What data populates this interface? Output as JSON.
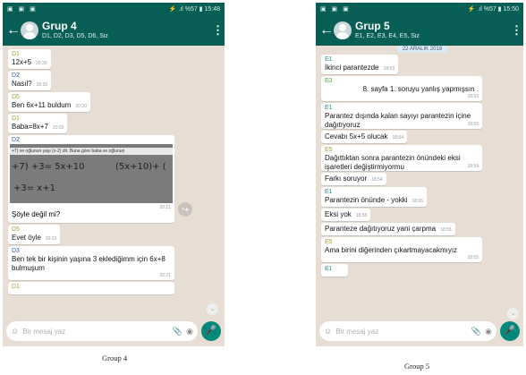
{
  "left": {
    "status": {
      "left": "▣ ▣ ▣",
      "right": "⚡ .ıl %57 ▮ 15:48"
    },
    "header": {
      "title": "Grup 4",
      "members": "D1, D2, D3, D5, D6, Siz"
    },
    "messages": [
      {
        "sender": "D1",
        "text": "12x+5",
        "time": "20:20"
      },
      {
        "sender": "D2",
        "text": "Nasıl?",
        "time": "20:20"
      },
      {
        "sender": "D5",
        "text": "Ben 6x+11 buldum",
        "time": "20:20"
      },
      {
        "sender": "D1",
        "text": "Baba=8x+7",
        "time": "20:20"
      },
      {
        "sender": "D2",
        "image_caption": "+7) ve oğlunun yaşı (x-2) dir. Buna göre baba ve oğlunun",
        "hw1": "+7) +3= 5x+10",
        "hw2": "(5x+10)+ (",
        "hw3": "+3= x+1",
        "text": "Şöyle değil mi?",
        "time": "20:21"
      },
      {
        "sender": "D5",
        "text": "Evet öyle",
        "time": "20:21"
      },
      {
        "sender": "D3",
        "text": "Ben tek bir kişinin yaşına 3 eklediğimm için 6x+8 bulmuşum",
        "time": "20:21"
      },
      {
        "sender": "D1",
        "text": "",
        "time": ""
      }
    ],
    "input_placeholder": "Bir mesaj yaz",
    "caption": "Group 4"
  },
  "right": {
    "status": {
      "left": "▣ ▣ ▣",
      "right": "⚡ .ıl %57 ▮ 15:50"
    },
    "header": {
      "title": "Grup 5",
      "members": "E1, E2, E3, E4, E5, Siz"
    },
    "date_pill": "22 ARALIK 2018",
    "messages": [
      {
        "sender": "E1",
        "text": "İkinci parantezde",
        "time": "18:53"
      },
      {
        "sender": "E3",
        "text": "8. sayfa 1. soruyu yanlış yapmışsın .",
        "time": "18:53"
      },
      {
        "sender": "E1",
        "text": "Parantez dışında kalan sayıyı parantezin içine dağıtıyoruz",
        "time": "18:53"
      },
      {
        "sender": "",
        "text": "Cevabı 5x+5 olucak",
        "time": "18:54"
      },
      {
        "sender": "E5",
        "text": "Dağıttıktan sonra parantezin önündeki eksi işaretleri değiştirmiyormu",
        "time": "18:54"
      },
      {
        "sender": "",
        "text": "Farkı soruyor",
        "time": "18:54"
      },
      {
        "sender": "E1",
        "text": "Parantezin önünde - yokki",
        "time": "18:55"
      },
      {
        "sender": "",
        "text": "Eksi yok",
        "time": "18:55"
      },
      {
        "sender": "",
        "text": "Paranteze dağıtıyoruz yani çarpma",
        "time": "18:55"
      },
      {
        "sender": "E5",
        "text": "Ama birini diğerinden çıkartmayacakmıyız",
        "time": "18:55"
      },
      {
        "sender": "E1",
        "text": "",
        "time": ""
      }
    ],
    "input_placeholder": "Bir mesaj yaz",
    "caption": "Group 5"
  },
  "icons": {
    "back": "←",
    "menu": "⋮",
    "emoji": "☺",
    "attach": "📎",
    "camera": "◉",
    "mic": "🎤",
    "forward": "↪",
    "scroll_down": "⌄"
  },
  "colors": {
    "header": "#075e54",
    "chat_bg": "#e7ddd3",
    "mic": "#00897b"
  }
}
